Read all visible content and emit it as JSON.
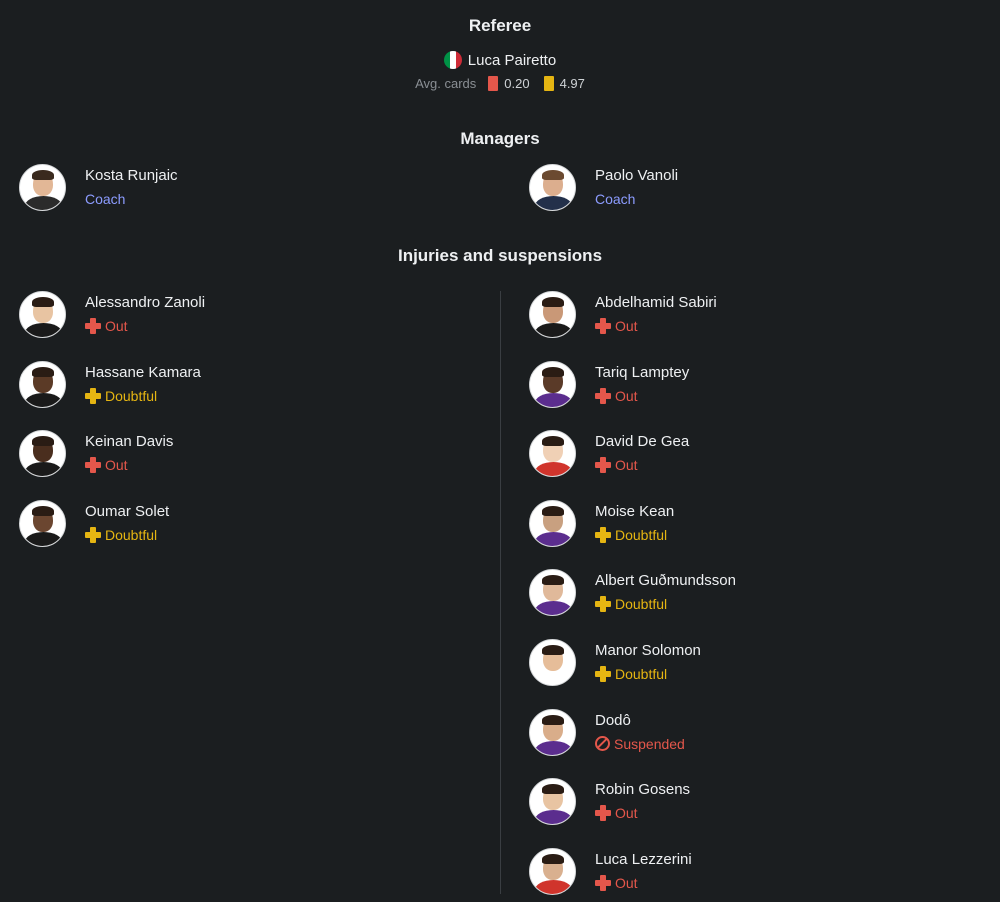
{
  "referee": {
    "title": "Referee",
    "name": "Luca Pairetto",
    "flag_icon": "italy-flag-icon",
    "flag_colors": [
      "#009246",
      "#ffffff",
      "#ce2b37"
    ],
    "avg_cards_label": "Avg. cards",
    "red_avg": "0.20",
    "yellow_avg": "4.97"
  },
  "managers": {
    "title": "Managers",
    "home": {
      "name": "Kosta Runjaic",
      "role": "Coach"
    },
    "away": {
      "name": "Paolo Vanoli",
      "role": "Coach"
    }
  },
  "injuries": {
    "title": "Injuries and suspensions",
    "home": [
      {
        "name": "Alessandro Zanoli",
        "status": "Out"
      },
      {
        "name": "Hassane Kamara",
        "status": "Doubtful"
      },
      {
        "name": "Keinan Davis",
        "status": "Out"
      },
      {
        "name": "Oumar Solet",
        "status": "Doubtful"
      }
    ],
    "away": [
      {
        "name": "Abdelhamid Sabiri",
        "status": "Out"
      },
      {
        "name": "Tariq Lamptey",
        "status": "Out"
      },
      {
        "name": "David De Gea",
        "status": "Out"
      },
      {
        "name": "Moise Kean",
        "status": "Doubtful"
      },
      {
        "name": "Albert Guðmundsson",
        "status": "Doubtful"
      },
      {
        "name": "Manor Solomon",
        "status": "Doubtful"
      },
      {
        "name": "Dodô",
        "status": "Suspended"
      },
      {
        "name": "Robin Gosens",
        "status": "Out"
      },
      {
        "name": "Luca Lezzerini",
        "status": "Out"
      }
    ]
  },
  "colors": {
    "background": "#1b1e20",
    "out": "#e4574b",
    "doubtful": "#e5b512",
    "coach": "#8c9cff",
    "red_card": "#e4574b",
    "yellow_card": "#e5b512"
  }
}
